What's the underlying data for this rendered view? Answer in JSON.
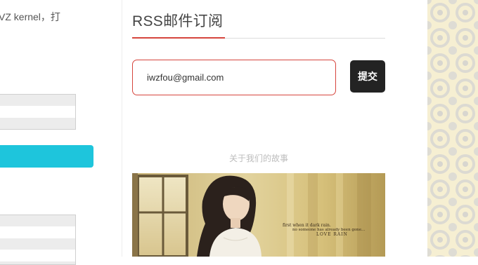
{
  "left_column": {
    "snippet_text": "VZ kernel，打"
  },
  "rss_widget": {
    "title": "RSS邮件订阅",
    "email_value": "iwzfou@gmail.com",
    "submit_label": "提交"
  },
  "about": {
    "caption": "关于我们的故事",
    "image_text_line1": "first when it dark rain.",
    "image_text_line2": "no someone has already been gone...",
    "image_text_brand": "LOVE RAIN"
  },
  "colors": {
    "accent_red": "#d6453d",
    "teal": "#1ec5dc",
    "button_dark": "#232323"
  }
}
